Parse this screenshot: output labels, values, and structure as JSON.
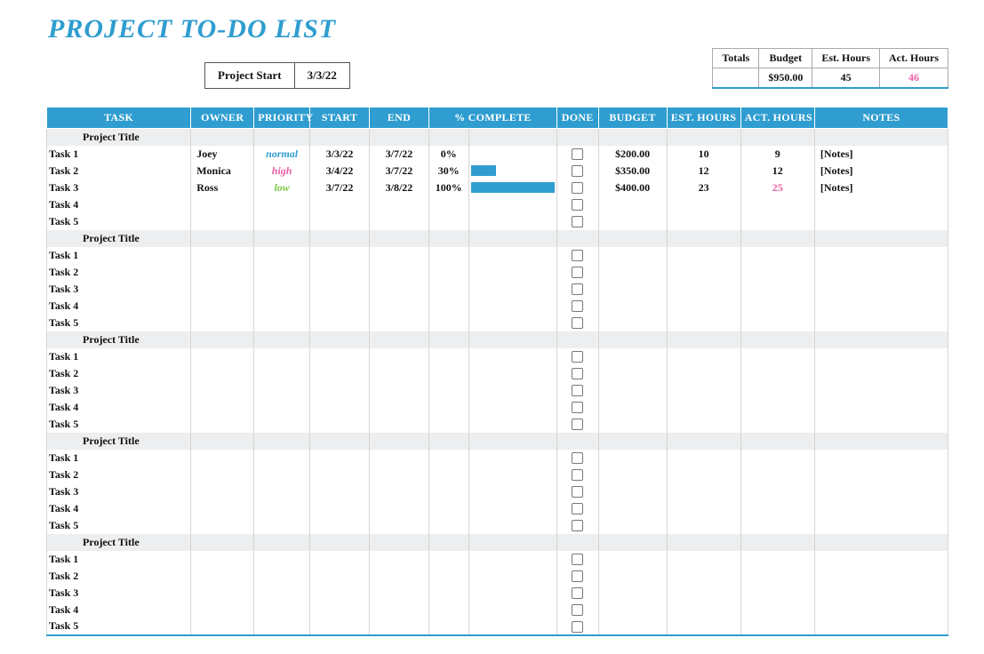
{
  "title": "PROJECT TO-DO LIST",
  "project_start": {
    "label": "Project Start",
    "value": "3/3/22"
  },
  "totals": {
    "headers": {
      "totals": "Totals",
      "budget": "Budget",
      "est_hours": "Est. Hours",
      "act_hours": "Act. Hours"
    },
    "budget": "$950.00",
    "est_hours": "45",
    "act_hours": "46"
  },
  "columns": {
    "task": "TASK",
    "owner": "OWNER",
    "priority": "PRIORITY",
    "start": "START",
    "end": "END",
    "pct": "% COMPLETE",
    "done": "DONE",
    "budget": "BUDGET",
    "est_hours": "EST. HOURS",
    "act_hours": "ACT. HOURS",
    "notes": "NOTES"
  },
  "section_label": "Project Title",
  "task_labels": [
    "Task 1",
    "Task 2",
    "Task 3",
    "Task 4",
    "Task 5"
  ],
  "sections": [
    {
      "tasks": [
        {
          "owner": "Joey",
          "priority": "normal",
          "priority_class": "prio-normal",
          "start": "3/3/22",
          "end": "3/7/22",
          "pct": "0%",
          "pct_num": 0,
          "budget": "$200.00",
          "est": "10",
          "act": "9",
          "act_warn": false,
          "notes": "[Notes]"
        },
        {
          "owner": "Monica",
          "priority": "high",
          "priority_class": "prio-high",
          "start": "3/4/22",
          "end": "3/7/22",
          "pct": "30%",
          "pct_num": 30,
          "budget": "$350.00",
          "est": "12",
          "act": "12",
          "act_warn": false,
          "notes": "[Notes]"
        },
        {
          "owner": "Ross",
          "priority": "low",
          "priority_class": "prio-low",
          "start": "3/7/22",
          "end": "3/8/22",
          "pct": "100%",
          "pct_num": 100,
          "budget": "$400.00",
          "est": "23",
          "act": "25",
          "act_warn": true,
          "notes": "[Notes]"
        },
        {},
        {}
      ]
    },
    {
      "tasks": [
        {},
        {},
        {},
        {},
        {}
      ]
    },
    {
      "tasks": [
        {},
        {},
        {},
        {},
        {}
      ]
    },
    {
      "tasks": [
        {},
        {},
        {},
        {},
        {}
      ]
    },
    {
      "tasks": [
        {},
        {},
        {},
        {},
        {}
      ]
    }
  ]
}
